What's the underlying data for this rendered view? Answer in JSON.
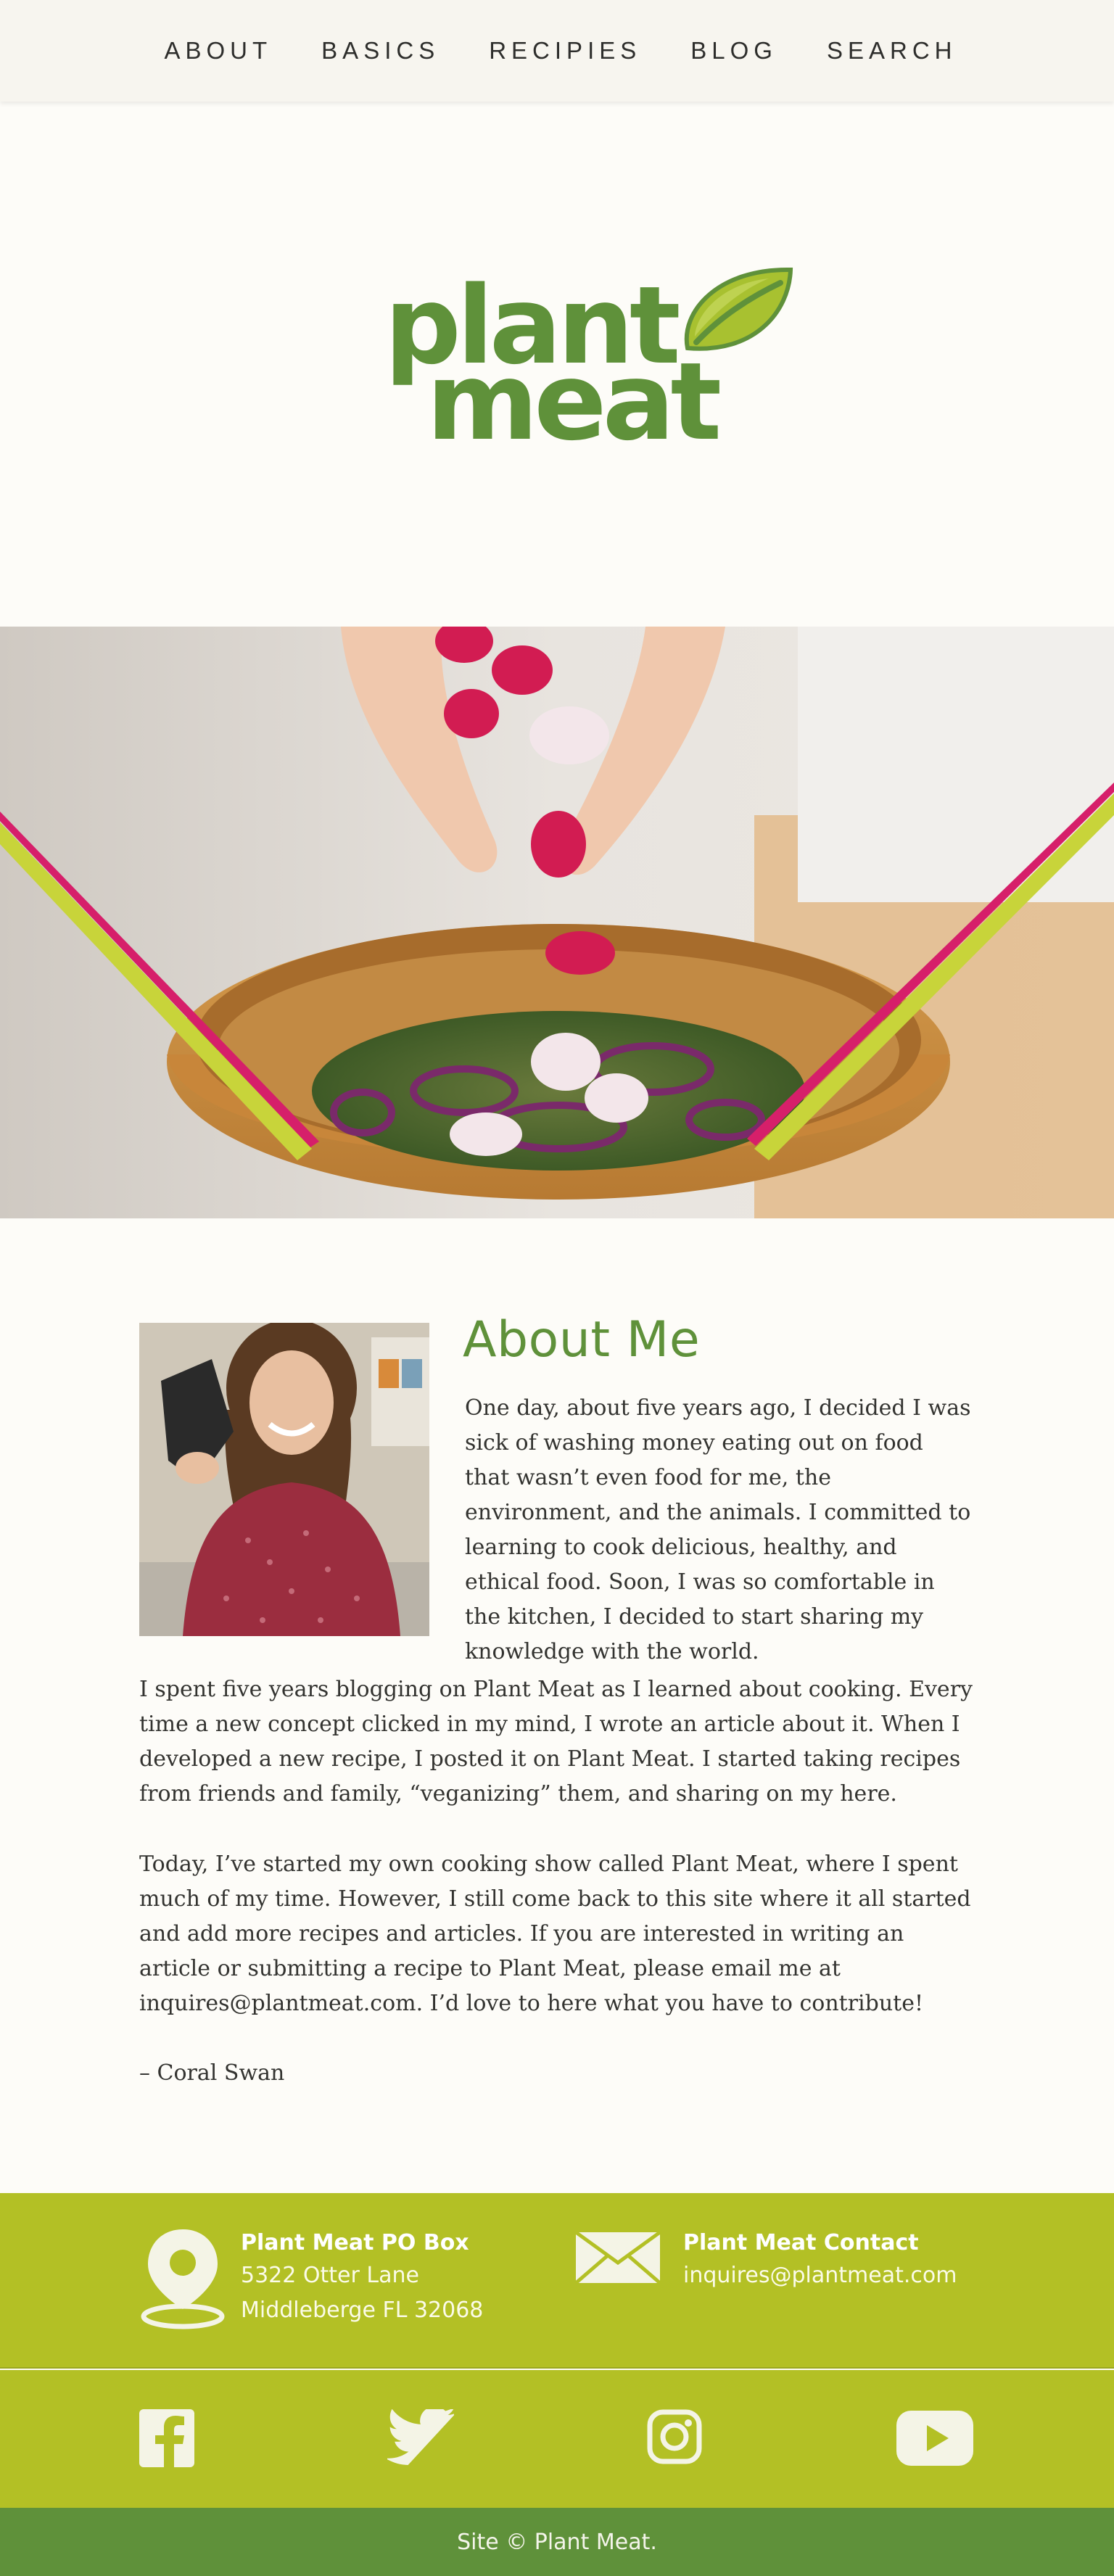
{
  "nav": {
    "items": [
      "ABOUT",
      "BASICS",
      "RECIPIES",
      "BLOG",
      "SEARCH"
    ]
  },
  "logo": {
    "line1": "plant",
    "line2": "meat",
    "icon": "leaf-icon"
  },
  "hero": {
    "icon": "salad-bowl-photo"
  },
  "about": {
    "title": "About Me",
    "photo_icon": "portrait-photo",
    "intro": "One day, about five years ago, I decided I was sick of washing money eating out on food that wasn’t even food for me, the environment, and the animals. I committed to learning to cook delicious, healthy, and ethical food. Soon, I was so comfortable in the kitchen, I decided to start sharing my knowledge with the world.",
    "paragraph1": "I spent five years blogging on Plant Meat as I learned about cooking. Every time a new concept clicked in my mind, I wrote an article about it. When I developed a new recipe, I posted it on Plant Meat. I started taking recipes from friends and family, “veganizing” them, and sharing on my here.",
    "paragraph2": "Today, I’ve started my own cooking show called Plant Meat, where I spent much of my time. However, I still come back to this site where it all started and add more recipes and articles. If you are interested in writing an article or submitting a recipe to Plant Meat, please email me at inquires@plantmeat.com. I’d love to here what you have to contribute!",
    "signature": "– Coral Swan"
  },
  "contact": {
    "po_box": {
      "icon": "map-pin-icon",
      "title": "Plant Meat PO Box",
      "line1": "5322 Otter Lane",
      "line2": "Middleberge FL 32068"
    },
    "email": {
      "icon": "envelope-icon",
      "title": "Plant Meat Contact",
      "address": "inquires@plantmeat.com"
    }
  },
  "social": [
    "facebook-icon",
    "twitter-icon",
    "instagram-icon",
    "youtube-icon"
  ],
  "footer": {
    "copyright": "Site © Plant Meat."
  },
  "colors": {
    "brand_green": "#5f913a",
    "lime": "#b3c025",
    "background": "#fdfcf8",
    "nav_background": "#f7f5ef"
  }
}
